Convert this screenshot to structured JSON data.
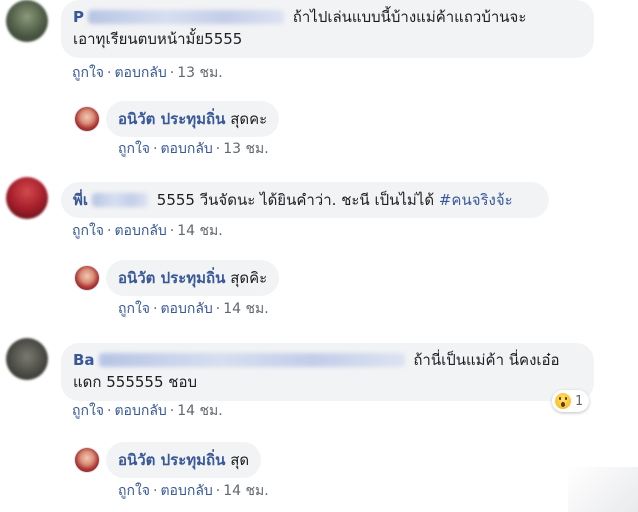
{
  "comments": [
    {
      "name_visible": "P",
      "text": "ถ้าไปเล่นแบบนี้บ้างแม่ค้าแถวบ้านจะ",
      "text2": "เอาทุเรียนตบหน้ามั้ย5555",
      "like": "ถูกใจ",
      "reply": "ตอบกลับ",
      "time": "13 ชม."
    },
    {
      "name": "อนิวัต ประทุมถิ่น",
      "text": "สุดคะ",
      "like": "ถูกใจ",
      "reply": "ตอบกลับ",
      "time": "13 ชม."
    },
    {
      "name_visible": "พี่เ",
      "text": "5555 วีนจัดนะ ได้ยินคำว่า. ชะนี เป็นไม่ได้",
      "hashtag": "#คนจริงจ้ะ",
      "like": "ถูกใจ",
      "reply": "ตอบกลับ",
      "time": "14 ชม."
    },
    {
      "name": "อนิวัต ประทุมถิ่น",
      "text": "สุดคิะ",
      "like": "ถูกใจ",
      "reply": "ตอบกลับ",
      "time": "14 ชม."
    },
    {
      "name_visible": "Ba",
      "text": "ถ้านี่เป็นแม่ค้า นี่คงเอ๋อ",
      "text2": "แดก 555555 ชอบ",
      "like": "ถูกใจ",
      "reply": "ตอบกลับ",
      "time": "14 ชม.",
      "reaction_count": "1"
    },
    {
      "name": "อนิวัต ประทุมถิ่น",
      "text": "สุด",
      "like": "ถูกใจ",
      "reply": "ตอบกลับ",
      "time": "14 ชม."
    }
  ],
  "separator": "·",
  "colors": {
    "bubble": "#f2f3f5",
    "name": "#385898",
    "meta": "#606770"
  }
}
